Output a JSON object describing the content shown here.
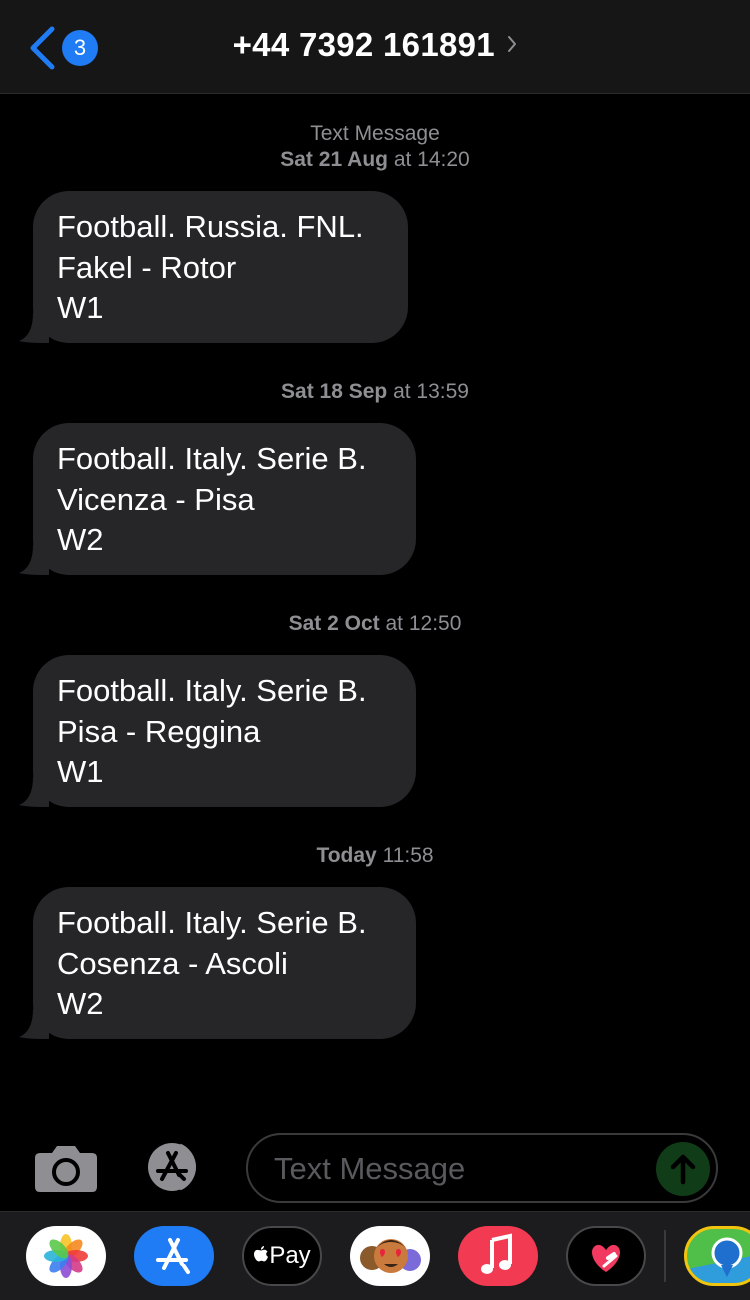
{
  "header": {
    "back_badge": "3",
    "contact": "+44 7392 161891"
  },
  "conversation": [
    {
      "label": "Text Message",
      "date": "Sat 21 Aug",
      "time": " at 14:20",
      "lines": [
        "Football. Russia. FNL.",
        "Fakel - Rotor",
        "W1"
      ]
    },
    {
      "label": "",
      "date": "Sat 18 Sep",
      "time": " at 13:59",
      "lines": [
        "Football. Italy. Serie B.",
        "Vicenza - Pisa",
        "W2"
      ]
    },
    {
      "label": "",
      "date": "Sat 2 Oct",
      "time": " at 12:50",
      "lines": [
        "Football. Italy. Serie B.",
        "Pisa - Reggina",
        "W1"
      ]
    },
    {
      "label": "",
      "date": "Today",
      "time": " 11:58",
      "lines": [
        "Football. Italy. Serie B.",
        "Cosenza - Ascoli",
        "W2"
      ]
    }
  ],
  "compose": {
    "placeholder": "Text Message"
  },
  "app_strip": {
    "apple_pay_label": "Pay",
    "apps": [
      "photos-app",
      "app-store-app",
      "apple-pay-app",
      "memoji-app",
      "music-app",
      "heart-app",
      "maps-app"
    ]
  },
  "colors": {
    "accent": "#1f7cf5",
    "bubble": "#262628",
    "timestamp": "#8e8e93",
    "send_button": "#103c18"
  }
}
